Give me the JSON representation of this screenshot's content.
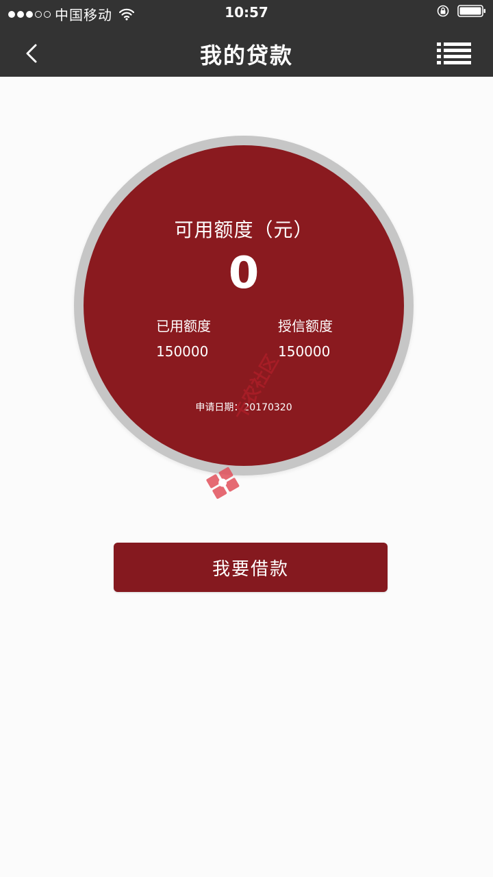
{
  "status_bar": {
    "carrier": "中国移动",
    "time": "10:57",
    "signal_filled": 3,
    "signal_total": 5
  },
  "nav": {
    "title": "我的贷款",
    "back_icon": "chevron-left-icon",
    "menu_icon": "list-menu-icon"
  },
  "credit_card": {
    "available_label": "可用额度（元）",
    "available_value": "0",
    "used_label": "已用额度",
    "used_value": "150000",
    "credit_label": "授信额度",
    "credit_value": "150000",
    "apply_date": "申请日期：20170320"
  },
  "actions": {
    "borrow_label": "我要借款"
  },
  "watermark": {
    "text": "卡农社区"
  },
  "colors": {
    "topbar": "#333333",
    "circle_red": "#8a1a1f",
    "button_red": "#85191f",
    "ring_gray": "#c6c6c6",
    "background": "#fbfbfb"
  }
}
